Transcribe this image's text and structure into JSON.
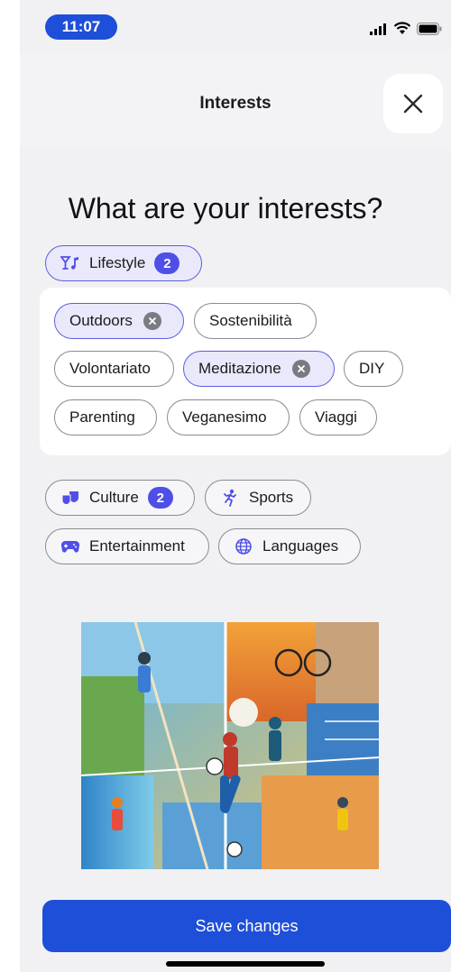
{
  "status_bar": {
    "time": "11:07",
    "icons": [
      "signal-icon",
      "wifi-icon",
      "battery-icon"
    ]
  },
  "header": {
    "title": "Interests",
    "close_icon": "close-icon"
  },
  "heading": "What are your interests?",
  "categories": {
    "lifestyle": {
      "label": "Lifestyle",
      "count": "2",
      "icon": "cocktail-music-icon",
      "expanded": true
    },
    "culture": {
      "label": "Culture",
      "count": "2",
      "icon": "theater-masks-icon"
    },
    "sports": {
      "label": "Sports",
      "icon": "running-person-icon"
    },
    "entertainment": {
      "label": "Entertainment",
      "icon": "gamepad-icon"
    },
    "languages": {
      "label": "Languages",
      "icon": "globe-icon"
    }
  },
  "lifestyle_options": {
    "outdoors": {
      "label": "Outdoors",
      "selected": true
    },
    "sostenibilita": {
      "label": "Sostenibilità",
      "selected": false
    },
    "volontariato": {
      "label": "Volontariato",
      "selected": false
    },
    "meditazione": {
      "label": "Meditazione",
      "selected": true
    },
    "diy": {
      "label": "DIY",
      "selected": false
    },
    "parenting": {
      "label": "Parenting",
      "selected": false
    },
    "veganesimo": {
      "label": "Veganesimo",
      "selected": false
    },
    "viaggi": {
      "label": "Viaggi",
      "selected": false
    }
  },
  "save_button": {
    "label": "Save changes"
  },
  "colors": {
    "accent": "#1e4fd8",
    "badge": "#4f4fe8",
    "selected_bg": "#e9e9fb",
    "selected_border": "#5b5fe0"
  }
}
